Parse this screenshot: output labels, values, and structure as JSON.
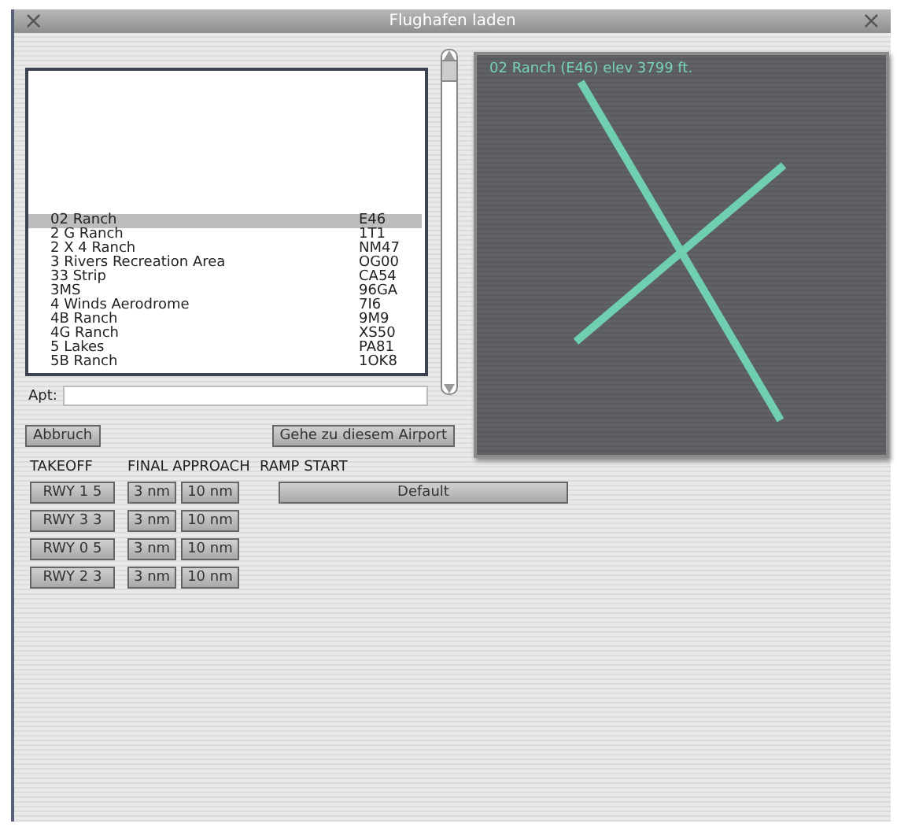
{
  "window": {
    "title": "Flughafen laden",
    "close_left": "×",
    "close_right": "×"
  },
  "airports": [
    {
      "name": "02 Ranch",
      "code": "E46",
      "selected": true
    },
    {
      "name": "2 G Ranch",
      "code": "1T1",
      "selected": false
    },
    {
      "name": "2 X 4 Ranch",
      "code": "NM47",
      "selected": false
    },
    {
      "name": "3 Rivers Recreation Area",
      "code": "OG00",
      "selected": false
    },
    {
      "name": "33 Strip",
      "code": "CA54",
      "selected": false
    },
    {
      "name": "3MS",
      "code": "96GA",
      "selected": false
    },
    {
      "name": "4 Winds Aerodrome",
      "code": "7I6",
      "selected": false
    },
    {
      "name": "4B Ranch",
      "code": "9M9",
      "selected": false
    },
    {
      "name": "4G Ranch",
      "code": "XS50",
      "selected": false
    },
    {
      "name": "5 Lakes",
      "code": "PA81",
      "selected": false
    },
    {
      "name": "5B Ranch",
      "code": "1OK8",
      "selected": false
    }
  ],
  "apt_field": {
    "label": "Apt:"
  },
  "preview": {
    "caption": "02 Ranch (E46) elev 3799 ft."
  },
  "buttons": {
    "cancel": "Abbruch",
    "go": "Gehe zu diesem Airport"
  },
  "headers": {
    "takeoff": "TAKEOFF",
    "final": "FINAL APPROACH",
    "ramp": "RAMP START"
  },
  "runways": [
    {
      "takeoff": "RWY 1 5",
      "near": "3 nm",
      "far": "10 nm"
    },
    {
      "takeoff": "RWY 3 3",
      "near": "3 nm",
      "far": "10 nm"
    },
    {
      "takeoff": "RWY 0 5",
      "near": "3 nm",
      "far": "10 nm"
    },
    {
      "takeoff": "RWY 2 3",
      "near": "3 nm",
      "far": "10 nm"
    }
  ],
  "ramp_start": "Default"
}
